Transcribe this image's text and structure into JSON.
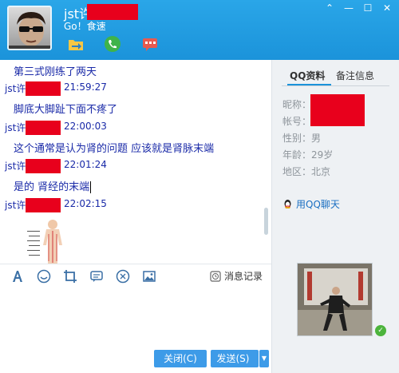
{
  "header": {
    "name": "jst许",
    "status": "Go！食速",
    "window_controls": [
      "chevron-up-icon",
      "minimize-icon",
      "maximize-icon",
      "close-icon"
    ]
  },
  "chat": {
    "messages": [
      {
        "type": "text",
        "text": "第三式刚练了两天"
      },
      {
        "type": "meta",
        "sender": "jst许",
        "time": "21:59:27"
      },
      {
        "type": "text",
        "text": "脚底大脚趾下面不疼了"
      },
      {
        "type": "meta",
        "sender": "jst许",
        "time": "22:00:03"
      },
      {
        "type": "text",
        "text": "这个通常是认为肾的问题 应该就是肾脉末端"
      },
      {
        "type": "meta",
        "sender": "jst许",
        "time": "22:01:24"
      },
      {
        "type": "text",
        "text": "是的 肾经的末端"
      },
      {
        "type": "meta",
        "sender": "jst许",
        "time": "22:02:15"
      }
    ]
  },
  "toolbar": {
    "icons": [
      "font-icon",
      "emoji-icon",
      "crop-icon",
      "chat-bubble-icon",
      "gift-icon",
      "image-icon"
    ],
    "history_label": "消息记录"
  },
  "input": {
    "close_label": "关闭(C)",
    "send_label": "发送(S)",
    "dropdown_label": "▼"
  },
  "profile": {
    "tabs": [
      "QQ资料",
      "备注信息"
    ],
    "fields": [
      {
        "label": "昵称：",
        "value": ""
      },
      {
        "label": "帐号：",
        "value": ""
      },
      {
        "label": "性别：",
        "value": "男"
      },
      {
        "label": "年龄：",
        "value": "29岁"
      },
      {
        "label": "地区：",
        "value": "北京"
      }
    ],
    "qq_chat_label": "用QQ聊天"
  },
  "colors": {
    "header_blue": "#1b93da",
    "message_blue": "#1a2aa8",
    "redaction": "#e8001c",
    "button_blue": "#3d9be8"
  }
}
